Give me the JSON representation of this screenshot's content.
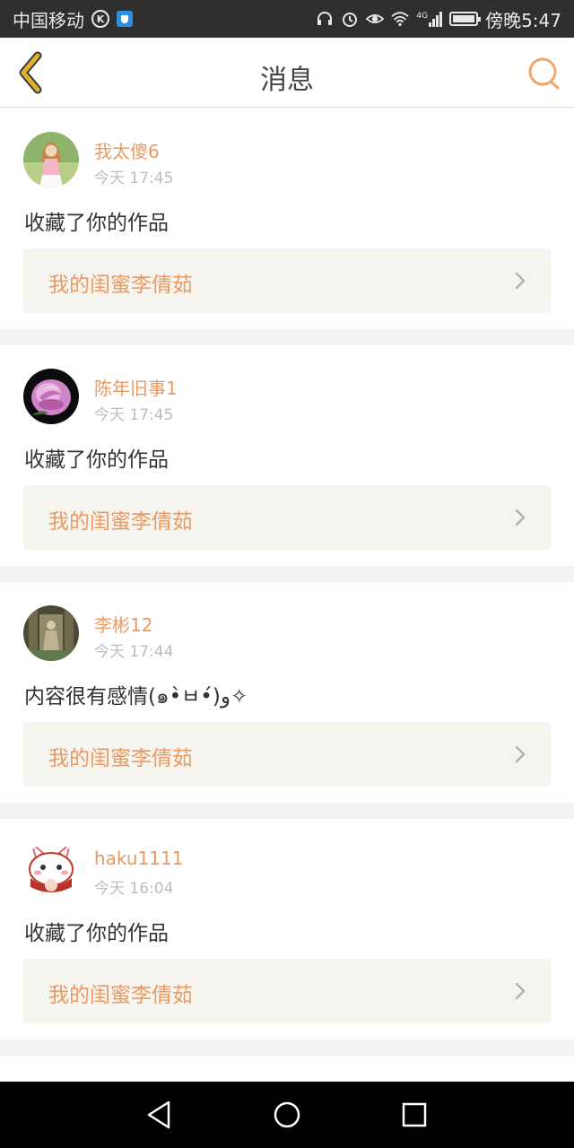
{
  "status_bar": {
    "carrier": "中国移动",
    "k_badge": "K",
    "network": "4G",
    "time": "傍晚5:47",
    "icons": [
      "k-circle-icon",
      "shield-app-icon",
      "headset-icon",
      "alarm-icon",
      "eye-icon",
      "wifi-icon",
      "signal-icon",
      "battery-icon"
    ]
  },
  "header": {
    "title": "消息",
    "back_icon": "chevron-left-icon",
    "search_icon": "search-icon"
  },
  "colors": {
    "accent": "#e99a63",
    "back_arrow": "#e0b12a",
    "search": "#f3a46a",
    "card_bg": "#ffffff",
    "work_bg": "#f5f4ef",
    "page_bg": "#f2f2f2"
  },
  "messages": [
    {
      "username": "我太傻6",
      "time": "今天 17:45",
      "action": "收藏了你的作品",
      "work_title": "我的闺蜜李倩茹"
    },
    {
      "username": "陈年旧事1",
      "time": "今天 17:45",
      "action": "收藏了你的作品",
      "work_title": "我的闺蜜李倩茹"
    },
    {
      "username": "李彬12",
      "time": "今天 17:44",
      "action": "内容很有感情(๑•̀ㅂ•́)و✧",
      "work_title": "我的闺蜜李倩茹"
    },
    {
      "username": "haku1111",
      "time": "今天 16:04",
      "action": "收藏了你的作品",
      "work_title": "我的闺蜜李倩茹"
    }
  ],
  "nav_bar": {
    "icons": [
      "back-triangle-icon",
      "home-circle-icon",
      "recents-square-icon"
    ]
  }
}
